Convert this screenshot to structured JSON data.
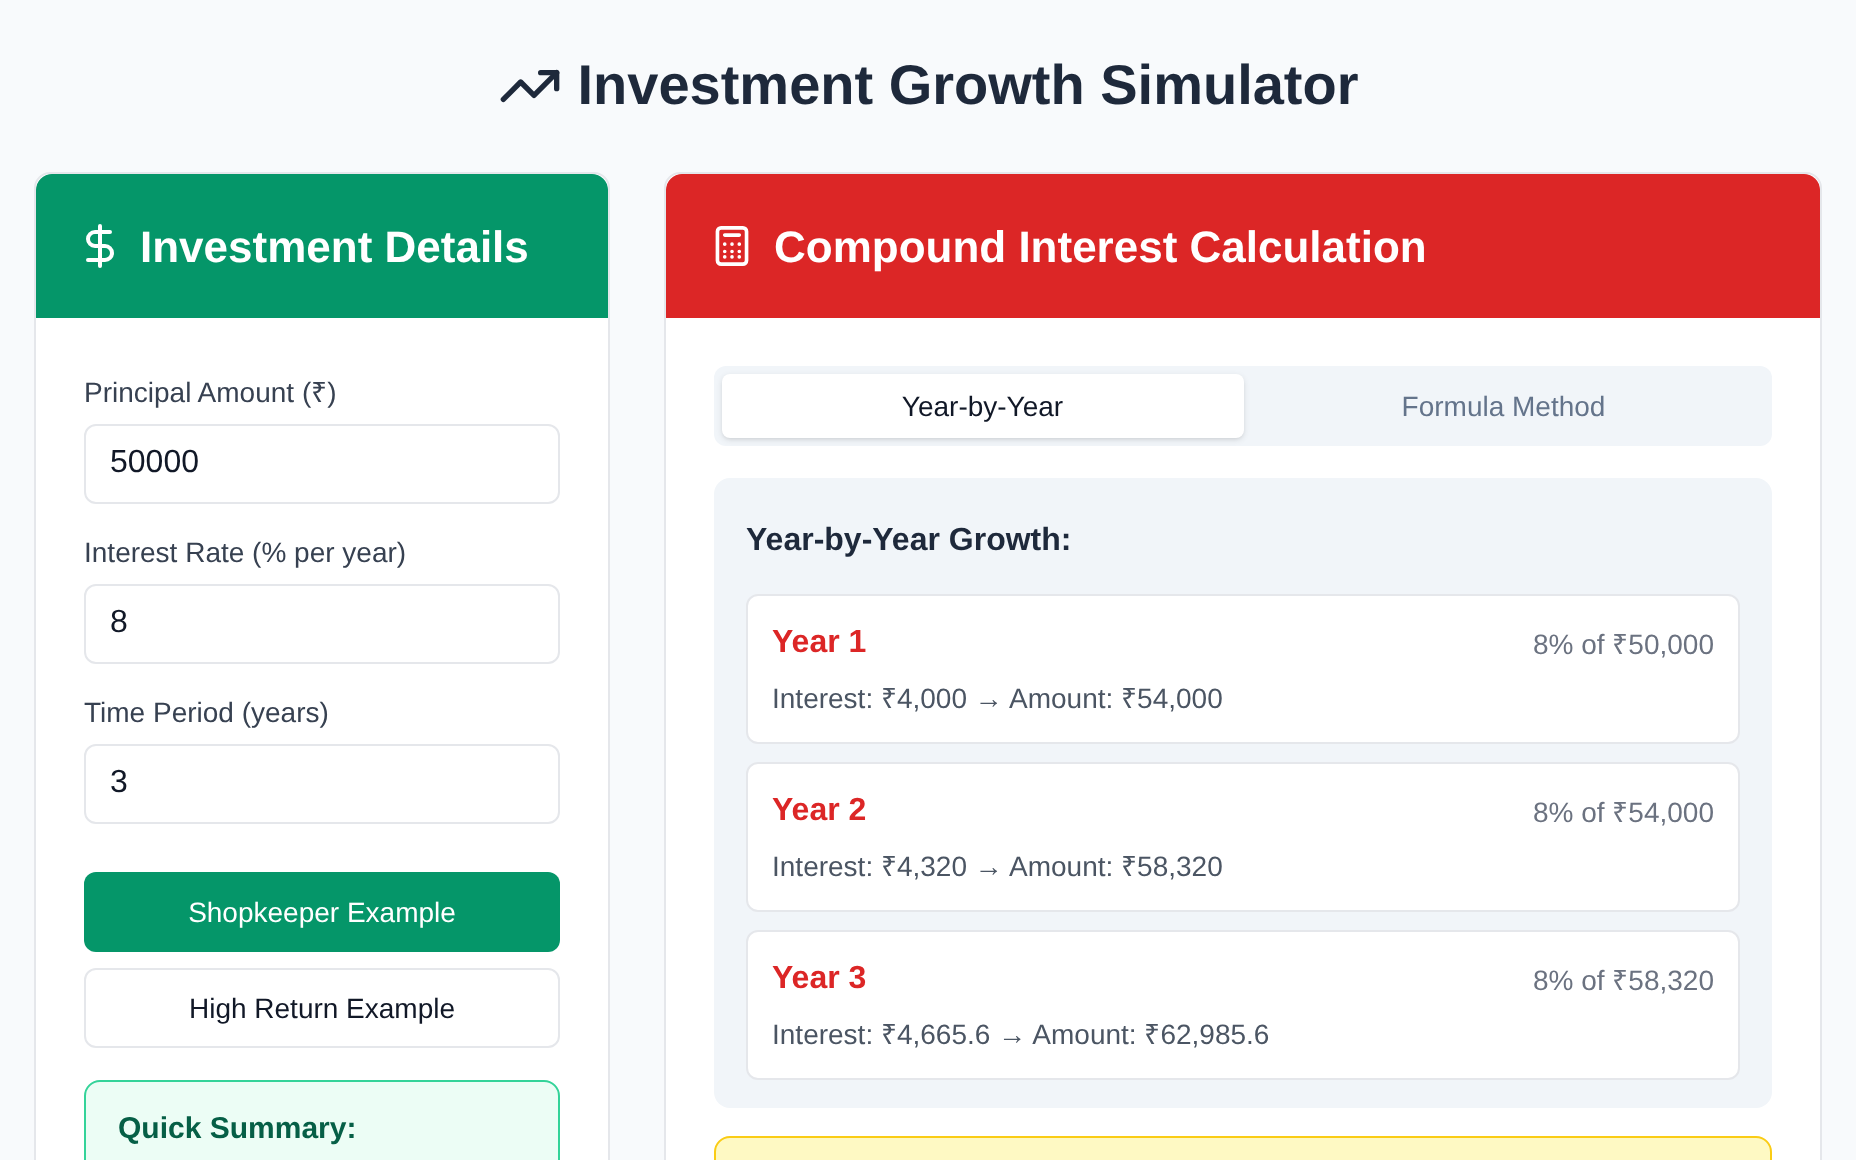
{
  "title": "Investment Growth Simulator",
  "details": {
    "heading": "Investment Details",
    "fields": [
      {
        "label": "Principal Amount (₹)",
        "value": "50000"
      },
      {
        "label": "Interest Rate (% per year)",
        "value": "8"
      },
      {
        "label": "Time Period (years)",
        "value": "3"
      }
    ],
    "buttons": [
      {
        "label": "Shopkeeper Example",
        "selected": true
      },
      {
        "label": "High Return Example",
        "selected": false
      }
    ],
    "summary": {
      "heading": "Quick Summary:"
    }
  },
  "calculation": {
    "heading": "Compound Interest Calculation",
    "tabs": [
      {
        "label": "Year-by-Year",
        "selected": true
      },
      {
        "label": "Formula Method",
        "selected": false
      }
    ],
    "growth_heading": "Year-by-Year Growth:",
    "years": [
      {
        "year": "Year 1",
        "rate": "8% of ₹50,000",
        "detail": "Interest: ₹4,000 → Amount: ₹54,000"
      },
      {
        "year": "Year 2",
        "rate": "8% of ₹54,000",
        "detail": "Interest: ₹4,320 → Amount: ₹58,320"
      },
      {
        "year": "Year 3",
        "rate": "8% of ₹58,320",
        "detail": "Interest: ₹4,665.6 → Amount: ₹62,985.6"
      }
    ]
  }
}
